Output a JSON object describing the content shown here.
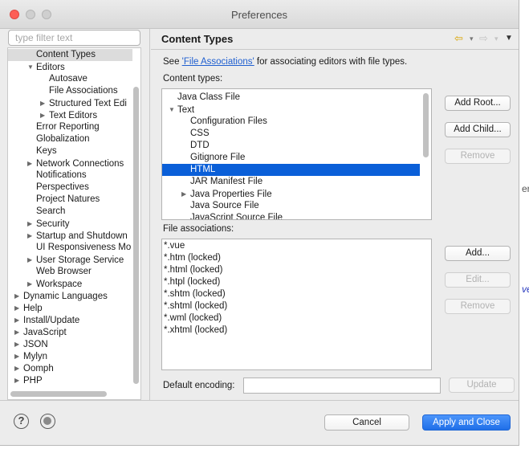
{
  "window": {
    "title": "Preferences"
  },
  "filter": {
    "placeholder": "type filter text"
  },
  "tree": [
    {
      "label": "Content Types",
      "indent": 2,
      "toggle": "",
      "selected": true
    },
    {
      "label": "Editors",
      "indent": 2,
      "toggle": "down"
    },
    {
      "label": "Autosave",
      "indent": 3,
      "toggle": ""
    },
    {
      "label": "File Associations",
      "indent": 3,
      "toggle": ""
    },
    {
      "label": "Structured Text Edi",
      "indent": 3,
      "toggle": "right"
    },
    {
      "label": "Text Editors",
      "indent": 3,
      "toggle": "right"
    },
    {
      "label": "Error Reporting",
      "indent": 2,
      "toggle": ""
    },
    {
      "label": "Globalization",
      "indent": 2,
      "toggle": ""
    },
    {
      "label": "Keys",
      "indent": 2,
      "toggle": ""
    },
    {
      "label": "Network Connections",
      "indent": 2,
      "toggle": "right"
    },
    {
      "label": "Notifications",
      "indent": 2,
      "toggle": ""
    },
    {
      "label": "Perspectives",
      "indent": 2,
      "toggle": ""
    },
    {
      "label": "Project Natures",
      "indent": 2,
      "toggle": ""
    },
    {
      "label": "Search",
      "indent": 2,
      "toggle": ""
    },
    {
      "label": "Security",
      "indent": 2,
      "toggle": "right"
    },
    {
      "label": "Startup and Shutdown",
      "indent": 2,
      "toggle": "right"
    },
    {
      "label": "UI Responsiveness Mo",
      "indent": 2,
      "toggle": ""
    },
    {
      "label": "User Storage Service",
      "indent": 2,
      "toggle": "right"
    },
    {
      "label": "Web Browser",
      "indent": 2,
      "toggle": ""
    },
    {
      "label": "Workspace",
      "indent": 2,
      "toggle": "right"
    },
    {
      "label": "Dynamic Languages",
      "indent": 1,
      "toggle": "right"
    },
    {
      "label": "Help",
      "indent": 1,
      "toggle": "right"
    },
    {
      "label": "Install/Update",
      "indent": 1,
      "toggle": "right"
    },
    {
      "label": "JavaScript",
      "indent": 1,
      "toggle": "right"
    },
    {
      "label": "JSON",
      "indent": 1,
      "toggle": "right"
    },
    {
      "label": "Mylyn",
      "indent": 1,
      "toggle": "right"
    },
    {
      "label": "Oomph",
      "indent": 1,
      "toggle": "right"
    },
    {
      "label": "PHP",
      "indent": 1,
      "toggle": "right"
    }
  ],
  "page": {
    "title": "Content Types",
    "description_prefix": "See ",
    "description_link": "'File Associations'",
    "description_suffix": " for associating editors with file types.",
    "content_types_label": "Content types:",
    "file_assoc_label": "File associations:",
    "default_encoding_label": "Default encoding:",
    "default_encoding_value": ""
  },
  "content_types": [
    {
      "label": "Java Class File",
      "indent": 1,
      "toggle": ""
    },
    {
      "label": "Text",
      "indent": 1,
      "toggle": "down"
    },
    {
      "label": "Configuration Files",
      "indent": 2,
      "toggle": ""
    },
    {
      "label": "CSS",
      "indent": 2,
      "toggle": ""
    },
    {
      "label": "DTD",
      "indent": 2,
      "toggle": ""
    },
    {
      "label": "Gitignore File",
      "indent": 2,
      "toggle": ""
    },
    {
      "label": "HTML",
      "indent": 2,
      "toggle": "",
      "selected": true
    },
    {
      "label": "JAR Manifest File",
      "indent": 2,
      "toggle": ""
    },
    {
      "label": "Java Properties File",
      "indent": 2,
      "toggle": "right"
    },
    {
      "label": "Java Source File",
      "indent": 2,
      "toggle": ""
    },
    {
      "label": "JavaScript Source File",
      "indent": 2,
      "toggle": ""
    }
  ],
  "file_associations": [
    "*.vue",
    "*.htm (locked)",
    "*.html (locked)",
    "*.htpl (locked)",
    "*.shtm (locked)",
    "*.shtml (locked)",
    "*.wml (locked)",
    "*.xhtml (locked)"
  ],
  "buttons": {
    "add_root": "Add Root...",
    "add_child": "Add Child...",
    "remove_type": "Remove",
    "add_assoc": "Add...",
    "edit_assoc": "Edit...",
    "remove_assoc": "Remove",
    "update": "Update",
    "cancel": "Cancel",
    "apply_close": "Apply and Close"
  },
  "icons": {
    "help": "?",
    "back": "⇦",
    "forward": "⇨",
    "menu": "▼",
    "dropdown": "▾"
  },
  "colors": {
    "accent": "#1f6fe8",
    "selection": "#0a5fd8",
    "link": "#1f5fd0"
  }
}
